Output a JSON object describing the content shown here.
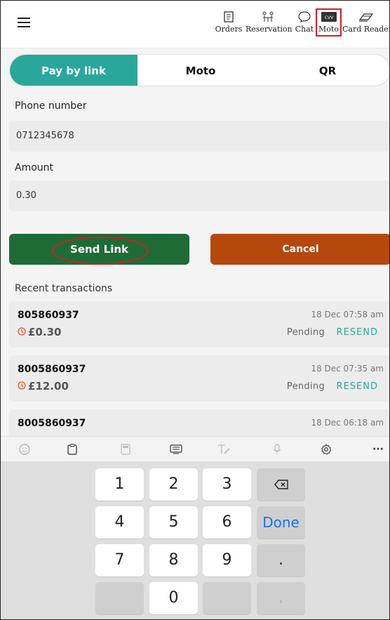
{
  "header": {
    "nav": [
      {
        "label": "Orders",
        "icon": "orders-icon"
      },
      {
        "label": "Reservation",
        "icon": "reservation-icon"
      },
      {
        "label": "Chat",
        "icon": "chat-icon"
      },
      {
        "label": "Moto",
        "icon": "cvv-card-icon"
      },
      {
        "label": "Card Reader",
        "icon": "card-reader-icon"
      }
    ]
  },
  "tabs": [
    {
      "label": "Pay by link",
      "active": true
    },
    {
      "label": "Moto",
      "active": false
    },
    {
      "label": "QR",
      "active": false
    }
  ],
  "form": {
    "phone_label": "Phone number",
    "phone_value": "0712345678",
    "amount_label": "Amount",
    "amount_value": "0.30"
  },
  "buttons": {
    "send": "Send Link",
    "cancel": "Cancel"
  },
  "recent": {
    "title": "Recent transactions",
    "items": [
      {
        "id": "805860937",
        "amount": "£0.30",
        "date": "18 Dec 07:58 am",
        "status": "Pending",
        "action": "RESEND"
      },
      {
        "id": "8005860937",
        "amount": "£12.00",
        "date": "18 Dec 07:35 am",
        "status": "Pending",
        "action": "RESEND"
      },
      {
        "id": "8005860937",
        "date": "18 Dec 06:18 am"
      }
    ]
  },
  "keyboard": {
    "keys": [
      "1",
      "2",
      "3",
      "4",
      "5",
      "6",
      "7",
      "8",
      "9",
      "0",
      ".",
      ","
    ],
    "done": "Done",
    "toolbar_icons": [
      "emoji-icon",
      "clipboard-icon",
      "calculator-icon",
      "keyboard-icon",
      "handwriting-icon",
      "microphone-icon",
      "settings-icon",
      "more-icon"
    ],
    "more": "···"
  },
  "colors": {
    "accent": "#2aa79b",
    "send": "#1e6b36",
    "cancel": "#b5480d",
    "highlight": "#d81b25",
    "pending_clock": "#e8531f"
  }
}
